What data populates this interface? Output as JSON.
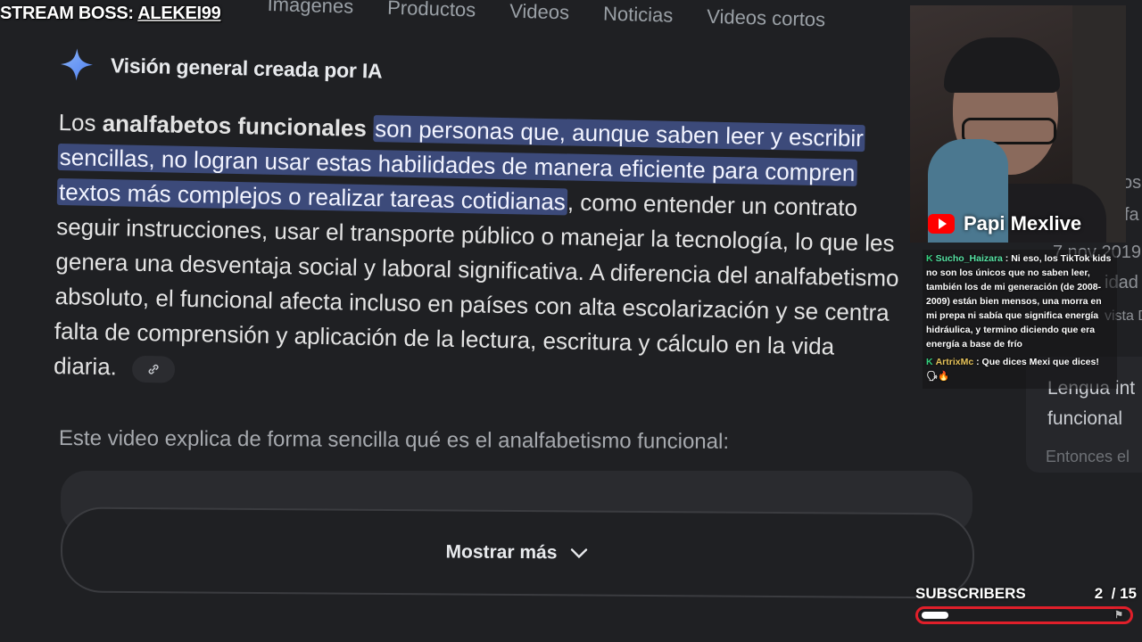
{
  "stream_boss": {
    "label": "STREAM BOSS:",
    "name": "ALEKEI99"
  },
  "tabs": [
    "Imágenes",
    "Productos",
    "Videos",
    "Noticias",
    "Videos cortos"
  ],
  "ai_overview": {
    "title": "Visión general creada por IA",
    "paragraph": {
      "line1_a": "Los ",
      "line1_bold": "analfabetos funcionales",
      "line1_hl": "son personas que, aunque saben leer y escribir",
      "line2_hl": "sencillas, no logran usar estas habilidades de manera eficiente para compren",
      "line3_hl": "textos más complejos o realizar tareas cotidianas",
      "line3_rest": ", como entender un contrato",
      "line4": "seguir instrucciones, usar el transporte público o manejar la tecnología, lo que les",
      "line5": "genera una desventaja social y laboral significativa. A diferencia del analfabetismo",
      "line6": "absoluto, el funcional afecta incluso en países con alta escolarización y se centra",
      "line7": "falta de comprensión y aplicación de la lectura, escritura y cálculo en la vida",
      "line8": "diaria."
    },
    "video_note": "Este video explica de forma sencilla qué es el analfabetismo funcional:",
    "show_more": "Mostrar más"
  },
  "side_peek": {
    "a": "os",
    "b": "fa",
    "c": "7 nov 2019 ·",
    "d": "idad",
    "e": "vista D",
    "card_title": "Lengua int",
    "card_sub": "funcional",
    "card_foot": "Entonces el"
  },
  "webcam": {
    "channel": "Papi Mexlive"
  },
  "chat": [
    {
      "user": "Sucho_Haizara",
      "text": ": Ni eso, los TikTok kids no son los únicos que no saben leer, también los de mi generación (de 2008-2009) están bien mensos, una morra en mi prepa ni sabía que significa energía hidráulica, y termino diciendo que era energía a base de frío"
    },
    {
      "user": "ArtrixMc",
      "text": ": Que dices Mexi que dices! 🗣🔥"
    }
  ],
  "subscribers": {
    "label": "SUBSCRIBERS",
    "current": "2",
    "goal": "/ 15",
    "progress": 0.13
  },
  "colors": {
    "highlight": "#3c4a7a",
    "goal_bar": "#e01f2a",
    "youtube": "#ff0000"
  }
}
